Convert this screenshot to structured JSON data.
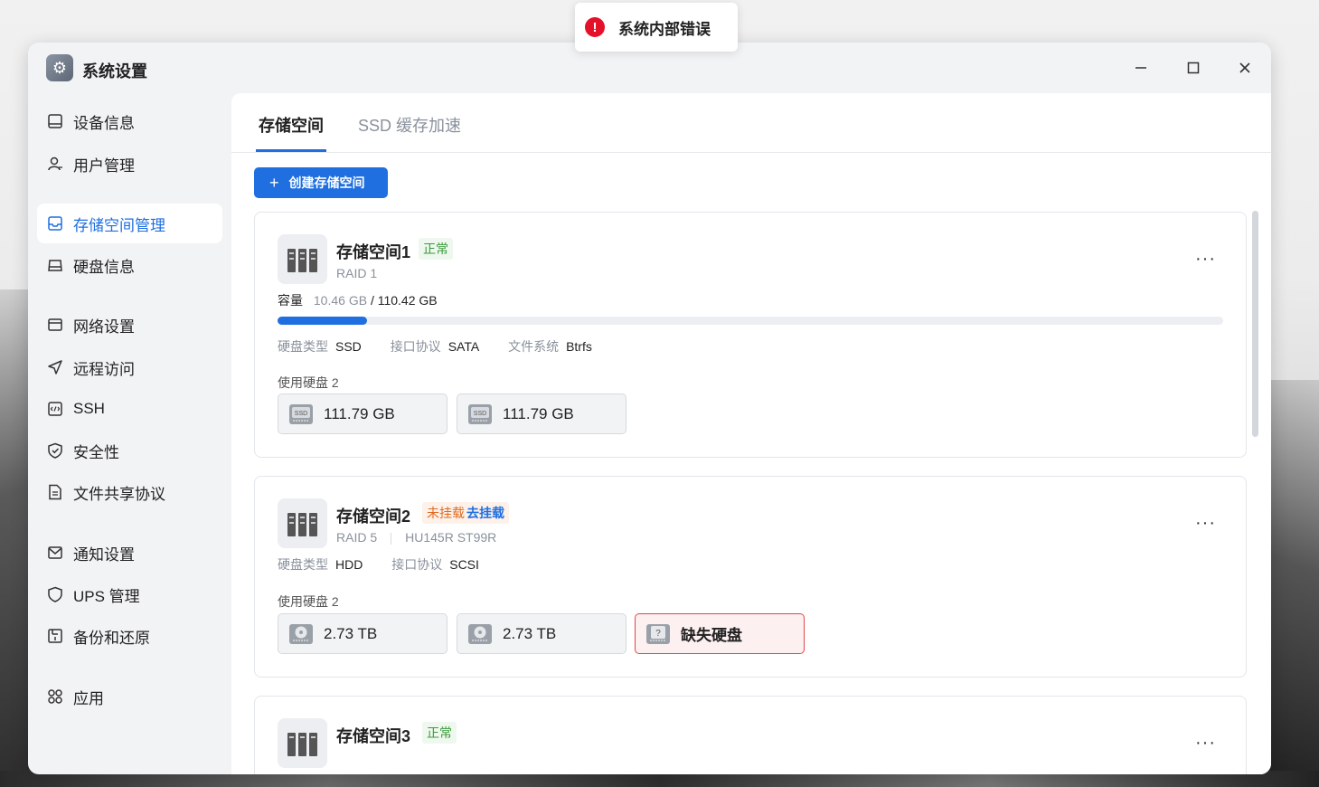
{
  "toast": {
    "message": "系统内部错误",
    "icon": "error-icon"
  },
  "window": {
    "title": "系统设置",
    "icon": "settings-gear-icon"
  },
  "sidebar": {
    "items": [
      {
        "label": "设备信息",
        "icon": "device-icon",
        "active": false
      },
      {
        "label": "用户管理",
        "icon": "user-icon",
        "active": false
      },
      {
        "label": "存储空间管理",
        "icon": "storage-icon",
        "active": true
      },
      {
        "label": "硬盘信息",
        "icon": "disk-icon",
        "active": false
      },
      {
        "label": "网络设置",
        "icon": "network-icon",
        "active": false
      },
      {
        "label": "远程访问",
        "icon": "send-icon",
        "active": false
      },
      {
        "label": "SSH",
        "icon": "code-icon",
        "active": false
      },
      {
        "label": "安全性",
        "icon": "shield-check-icon",
        "active": false
      },
      {
        "label": "文件共享协议",
        "icon": "file-icon",
        "active": false
      },
      {
        "label": "通知设置",
        "icon": "mail-icon",
        "active": false
      },
      {
        "label": "UPS 管理",
        "icon": "shield-icon",
        "active": false
      },
      {
        "label": "备份和还原",
        "icon": "backup-icon",
        "active": false
      },
      {
        "label": "应用",
        "icon": "apps-icon",
        "active": false
      }
    ]
  },
  "tabs": [
    {
      "label": "存储空间",
      "active": true
    },
    {
      "label": "SSD 缓存加速",
      "active": false
    }
  ],
  "create_button": {
    "label": "创建存储空间"
  },
  "pools": [
    {
      "name": "存储空间1",
      "status": "正常",
      "raid": "RAID 1",
      "capacity_label": "容量",
      "used": "10.46 GB",
      "total": "/ 110.42 GB",
      "usage_fraction": 0.095,
      "meta": [
        {
          "label": "硬盘类型",
          "value": "SSD"
        },
        {
          "label": "接口协议",
          "value": "SATA"
        },
        {
          "label": "文件系统",
          "value": "Btrfs"
        }
      ],
      "disks_label": "使用硬盘 2",
      "disks": [
        {
          "size": "111.79 GB",
          "type": "ssd"
        },
        {
          "size": "111.79 GB",
          "type": "ssd"
        }
      ]
    },
    {
      "name": "存储空间2",
      "status": "未挂载",
      "status_action": "去挂载",
      "raid": "RAID 5",
      "model": "HU145R ST99R",
      "meta": [
        {
          "label": "硬盘类型",
          "value": "HDD"
        },
        {
          "label": "接口协议",
          "value": "SCSI"
        }
      ],
      "disks_label": "使用硬盘 2",
      "disks": [
        {
          "size": "2.73 TB",
          "type": "hdd"
        },
        {
          "size": "2.73 TB",
          "type": "hdd"
        },
        {
          "size": "缺失硬盘",
          "type": "missing"
        }
      ]
    },
    {
      "name": "存储空间3",
      "status": "正常"
    }
  ],
  "colors": {
    "accent": "#1f6fe0",
    "ok": "#3d9a3d",
    "warn": "#e06b20",
    "error": "#e5112a"
  }
}
